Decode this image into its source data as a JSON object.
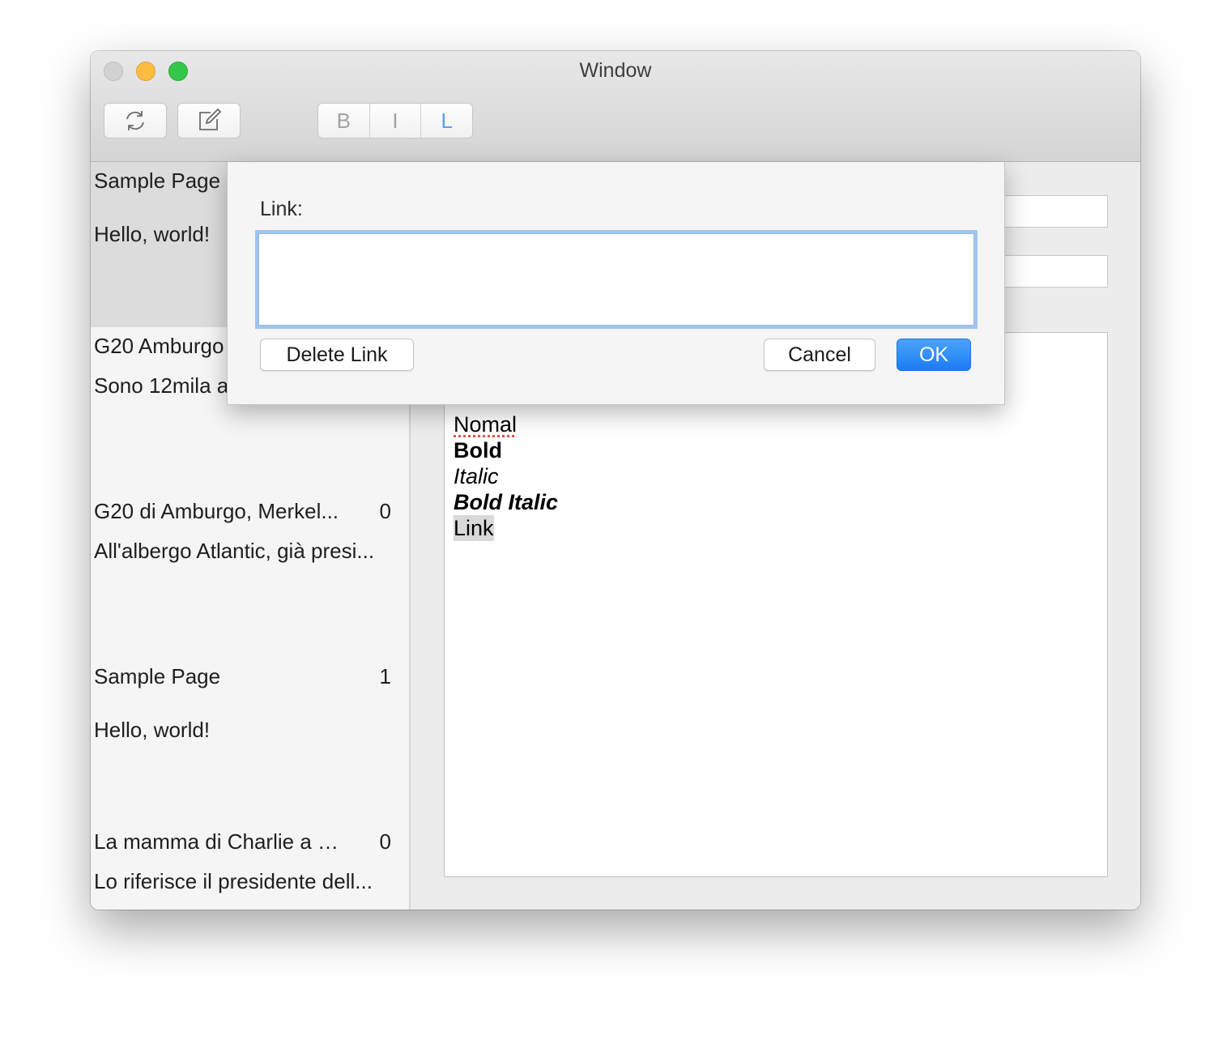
{
  "window": {
    "title": "Window"
  },
  "toolbar": {
    "refresh_icon": "refresh-icon",
    "compose_icon": "compose-icon",
    "format_segments": [
      "B",
      "I",
      "L"
    ]
  },
  "sidebar": {
    "items": [
      {
        "title": "Sample Page",
        "count": "",
        "subtitle": "Hello, world!",
        "selected": true
      },
      {
        "title": "G20 Amburgo",
        "count": "",
        "subtitle": "Sono 12mila a"
      },
      {
        "title": "G20 di Amburgo, Merkel...",
        "count": "0",
        "subtitle": "All'albergo Atlantic, già presi..."
      },
      {
        "title": "Sample Page",
        "count": "1",
        "subtitle": "Hello, world!"
      },
      {
        "title": "La mamma di Charlie a Mi...",
        "count": "0",
        "subtitle": "Lo riferisce il presidente dell..."
      }
    ]
  },
  "editor": {
    "lines": {
      "normal": "Nomal",
      "bold": "Bold",
      "italic": "Italic",
      "bold_italic": "Bold Italic",
      "link": "Link"
    }
  },
  "link_sheet": {
    "label": "Link:",
    "input_value": "",
    "delete_label": "Delete Link",
    "cancel_label": "Cancel",
    "ok_label": "OK"
  },
  "colors": {
    "accent": "#1b7cf4",
    "focus_ring": "#9dc5f3",
    "selected_row": "#dcdcdc"
  }
}
